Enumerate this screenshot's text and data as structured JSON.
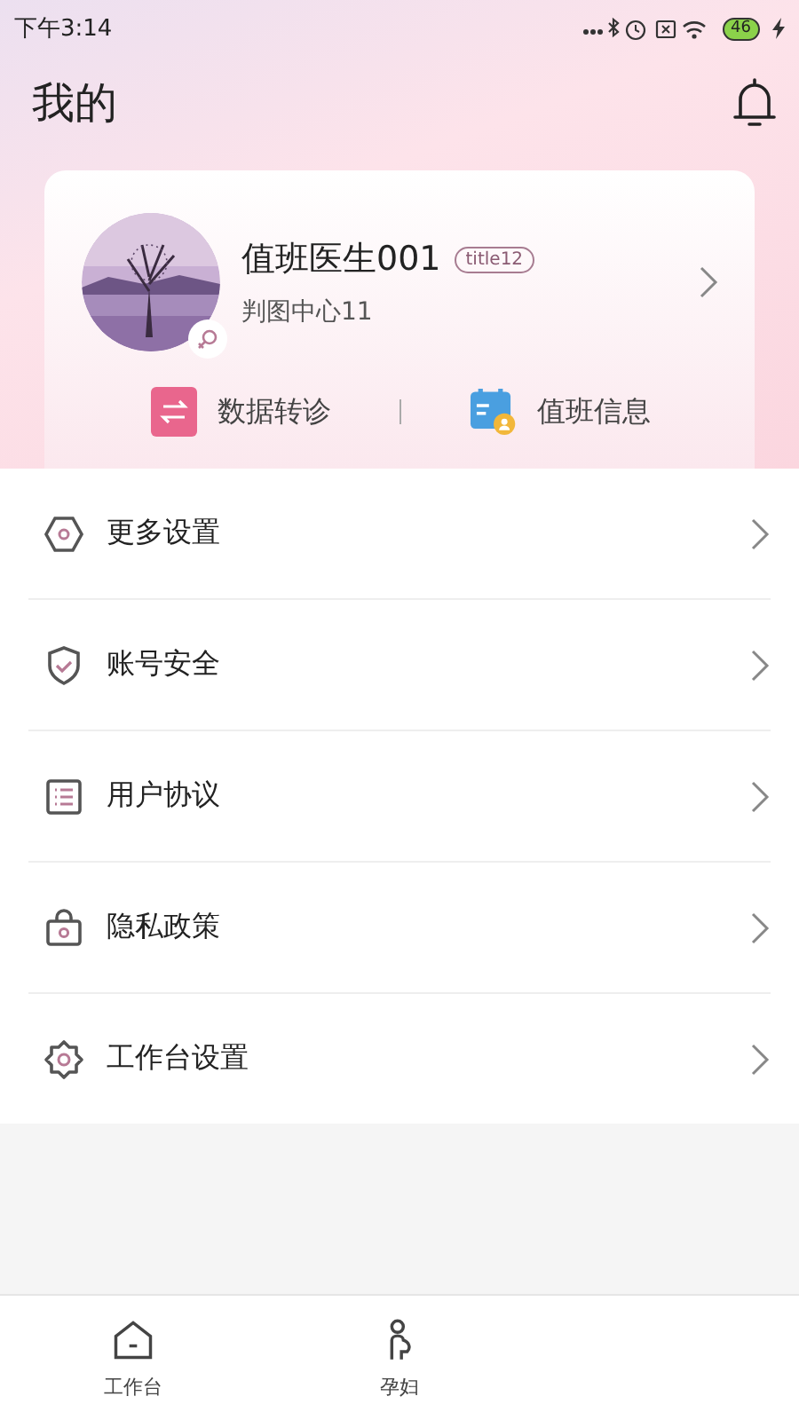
{
  "status_bar": {
    "time": "下午3:14",
    "battery": "46"
  },
  "header": {
    "title": "我的"
  },
  "profile": {
    "name": "值班医生001",
    "tag": "title12",
    "subtitle": "判图中心11"
  },
  "shortcuts": [
    {
      "label": "数据转诊",
      "kind": "transfer"
    },
    {
      "label": "值班信息",
      "kind": "schedule"
    }
  ],
  "menu": [
    {
      "label": "更多设置",
      "kind": "hexagon"
    },
    {
      "label": "账号安全",
      "kind": "shield"
    },
    {
      "label": "用户协议",
      "kind": "list"
    },
    {
      "label": "隐私政策",
      "kind": "bag"
    },
    {
      "label": "工作台设置",
      "kind": "gear"
    }
  ],
  "tab_bar": [
    {
      "label": "工作台",
      "kind": "home",
      "selected": false
    },
    {
      "label": "孕妇",
      "kind": "person",
      "selected": false
    }
  ]
}
